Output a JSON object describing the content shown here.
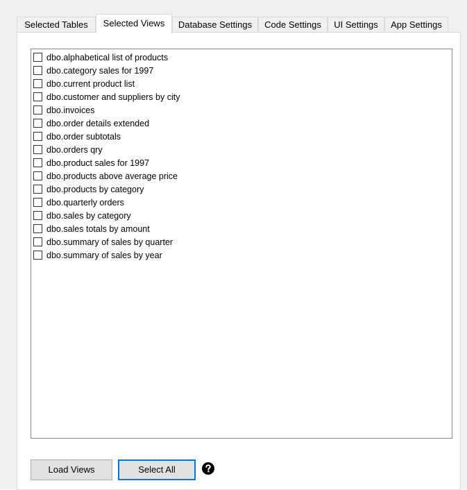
{
  "tabs": [
    {
      "label": "Selected Tables",
      "active": false
    },
    {
      "label": "Selected Views",
      "active": true
    },
    {
      "label": "Database Settings",
      "active": false
    },
    {
      "label": "Code Settings",
      "active": false
    },
    {
      "label": "UI Settings",
      "active": false
    },
    {
      "label": "App Settings",
      "active": false
    }
  ],
  "views_list": {
    "items": [
      {
        "label": "dbo.alphabetical list of products",
        "checked": false
      },
      {
        "label": "dbo.category sales for 1997",
        "checked": false
      },
      {
        "label": "dbo.current product list",
        "checked": false
      },
      {
        "label": "dbo.customer and suppliers by city",
        "checked": false
      },
      {
        "label": "dbo.invoices",
        "checked": false
      },
      {
        "label": "dbo.order details extended",
        "checked": false
      },
      {
        "label": "dbo.order subtotals",
        "checked": false
      },
      {
        "label": "dbo.orders qry",
        "checked": false
      },
      {
        "label": "dbo.product sales for 1997",
        "checked": false
      },
      {
        "label": "dbo.products above average price",
        "checked": false
      },
      {
        "label": "dbo.products by category",
        "checked": false
      },
      {
        "label": "dbo.quarterly orders",
        "checked": false
      },
      {
        "label": "dbo.sales by category",
        "checked": false
      },
      {
        "label": "dbo.sales totals by amount",
        "checked": false
      },
      {
        "label": "dbo.summary of sales by quarter",
        "checked": false
      },
      {
        "label": "dbo.summary of sales by year",
        "checked": false
      }
    ]
  },
  "buttons": {
    "load_views": "Load Views",
    "select_all": "Select All"
  },
  "help_icon": "question-circle-icon",
  "colors": {
    "focus_border": "#0078d7",
    "tab_border": "#d9d9d9",
    "button_bg": "#e1e1e1"
  }
}
